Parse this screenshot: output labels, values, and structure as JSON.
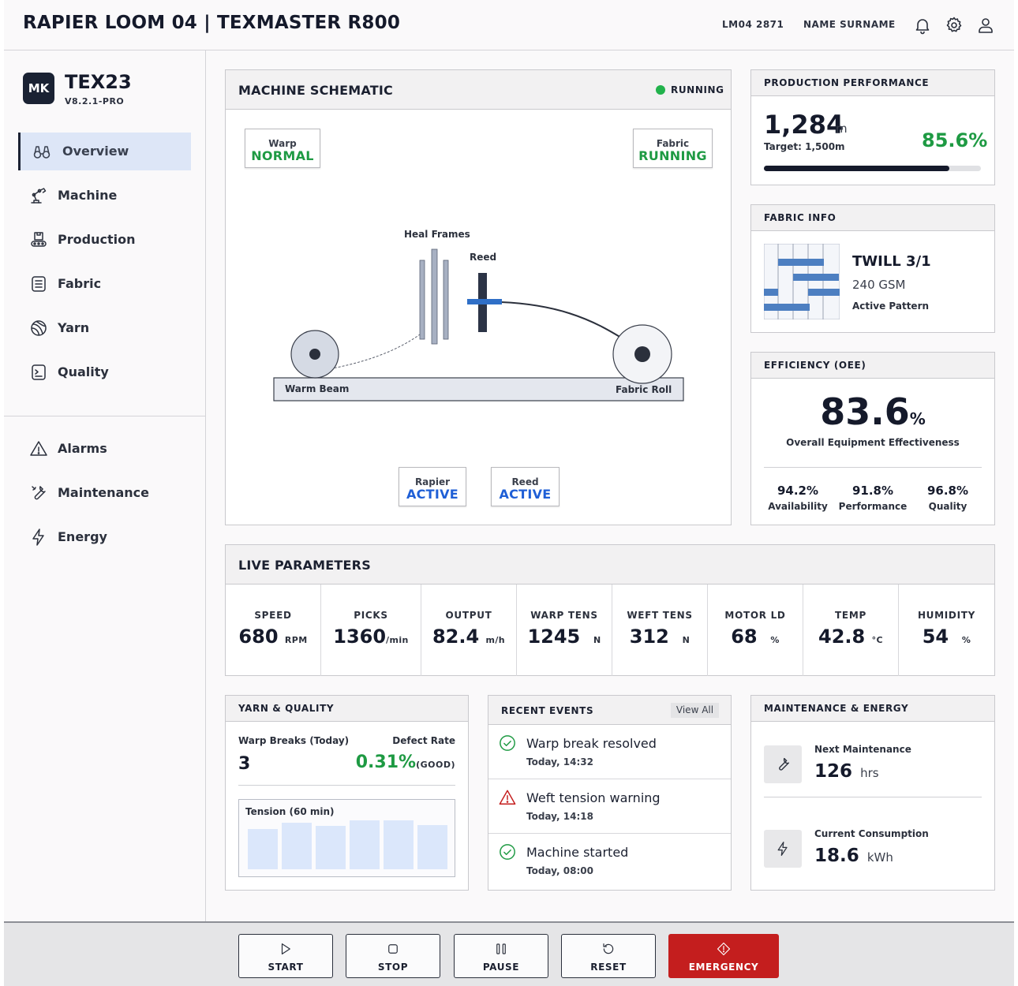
{
  "header": {
    "title": "RAPIER LOOM 04 | TEXMASTER R800",
    "machine_id": "LM04 2871",
    "user_name": "NAME SURNAME",
    "icons": [
      "bell-icon",
      "gear-icon",
      "user-icon"
    ]
  },
  "sidebar": {
    "avatar": "MK",
    "brand": "TEX23",
    "version": "V8.2.1-PRO",
    "items": [
      {
        "label": "Overview",
        "icon": "binoculars-icon",
        "active": true
      },
      {
        "label": "Machine",
        "icon": "robot-arm-icon"
      },
      {
        "label": "Production",
        "icon": "conveyor-icon"
      },
      {
        "label": "Fabric",
        "icon": "fabric-icon"
      },
      {
        "label": "Yarn",
        "icon": "yarn-icon"
      },
      {
        "label": "Quality",
        "icon": "quality-icon"
      }
    ],
    "secondary_items": [
      {
        "label": "Alarms",
        "icon": "warning-icon"
      },
      {
        "label": "Maintenance",
        "icon": "wrench-icon"
      },
      {
        "label": "Energy",
        "icon": "lightning-icon"
      }
    ]
  },
  "schematic": {
    "title": "MACHINE SCHEMATIC",
    "status": "RUNNING",
    "warp": {
      "label": "Warp",
      "value": "NORMAL"
    },
    "fabric": {
      "label": "Fabric",
      "value": "RUNNING"
    },
    "rapier": {
      "label": "Rapier",
      "value": "ACTIVE"
    },
    "reed_tag": {
      "label": "Reed",
      "value": "ACTIVE"
    },
    "labels": {
      "heal_frames": "Heal Frames",
      "reed": "Reed",
      "warm_beam": "Warm Beam",
      "fabric_roll": "Fabric Roll"
    }
  },
  "production": {
    "title": "PRODUCTION PERFORMANCE",
    "value": "1,284",
    "unit": "m",
    "target": "Target: 1,500m",
    "percent": "85.6%",
    "progress_fraction": 0.856
  },
  "fabric_info": {
    "title": "FABRIC INFO",
    "name": "TWILL 3/1",
    "weight": "240 GSM",
    "pattern_label": "Active Pattern"
  },
  "oee": {
    "title": "EFFICIENCY (OEE)",
    "value": "83.6",
    "unit": "%",
    "label": "Overall Equipment Effectiveness",
    "metrics": [
      {
        "value": "94.2%",
        "label": "Availability"
      },
      {
        "value": "91.8%",
        "label": "Performance"
      },
      {
        "value": "96.8%",
        "label": "Quality"
      }
    ]
  },
  "live": {
    "title": "LIVE PARAMETERS",
    "params": [
      {
        "label": "SPEED",
        "value": "680",
        "unit": "RPM"
      },
      {
        "label": "PICKS",
        "value": "1360",
        "unit": "/min"
      },
      {
        "label": "OUTPUT",
        "value": "82.4",
        "unit": "m/h"
      },
      {
        "label": "WARP TENS",
        "value": "1245",
        "unit": "N"
      },
      {
        "label": "WEFT TENS",
        "value": "312",
        "unit": "N"
      },
      {
        "label": "MOTOR LD",
        "value": "68",
        "unit": "%"
      },
      {
        "label": "TEMP",
        "value": "42.8",
        "unit": "°C"
      },
      {
        "label": "HUMIDITY",
        "value": "54",
        "unit": "%"
      }
    ]
  },
  "yarn_quality": {
    "title": "YARN & QUALITY",
    "warp_breaks_label": "Warp Breaks (Today)",
    "warp_breaks_value": "3",
    "defect_label": "Defect Rate",
    "defect_value": "0.31%",
    "defect_status": "(GOOD)",
    "tension_label": "Tension (60 min)",
    "tension_bars": [
      0.82,
      0.95,
      0.88,
      1.0,
      1.0,
      0.9
    ]
  },
  "events": {
    "title": "RECENT EVENTS",
    "view_all": "View All",
    "items": [
      {
        "title": "Warp break resolved",
        "time": "Today, 14:32",
        "icon": "check-circle-icon"
      },
      {
        "title": "Weft tension warning",
        "time": "Today, 14:18",
        "icon": "warning-icon"
      },
      {
        "title": "Machine started",
        "time": "Today, 08:00",
        "icon": "check-circle-icon"
      }
    ]
  },
  "maintenance_energy": {
    "title": "MAINTENANCE & ENERGY",
    "next_label": "Next Maintenance",
    "next_value": "126",
    "next_unit": "hrs",
    "consumption_label": "Current Consumption",
    "consumption_value": "18.6",
    "consumption_unit": "kWh"
  },
  "controls": {
    "start": "START",
    "stop": "STOP",
    "pause": "PAUSE",
    "reset": "RESET",
    "emergency": "EMERGENCY"
  },
  "colors": {
    "green": "#1e9a43",
    "blue": "#1f5fd6",
    "red": "#c41e1e",
    "navy": "#151a2b",
    "active_nav": "#dde6f7"
  }
}
